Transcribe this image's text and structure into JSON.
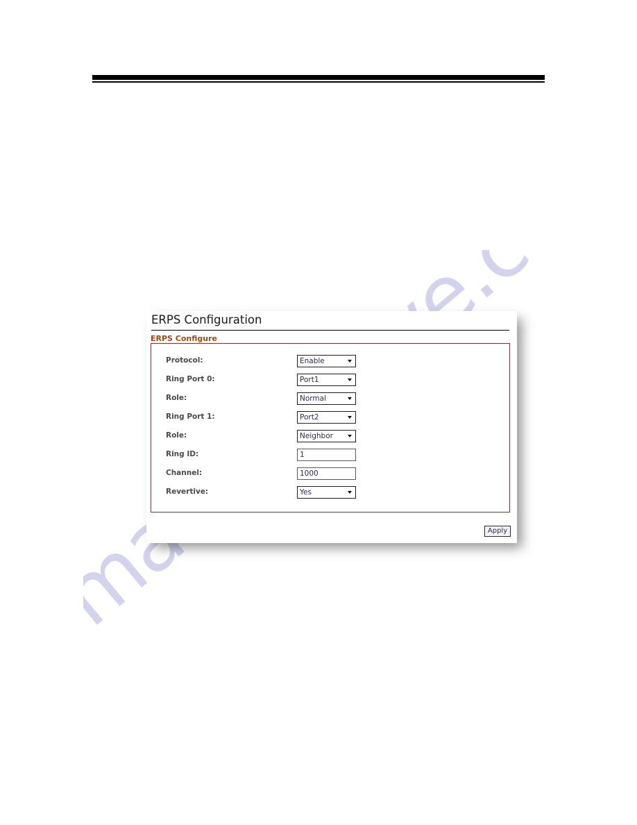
{
  "page": {
    "top_rule": "horizontal-rule"
  },
  "watermark": {
    "text": "manualshive.com",
    "color": "#b9b9e4"
  },
  "card": {
    "title": "ERPS Configuration",
    "fieldset_legend": "ERPS Configure",
    "legend_color": "#9c4a16",
    "border_color": "#8e2b2b",
    "apply_label": "Apply",
    "rows": [
      {
        "label": "Protocol:",
        "type": "select",
        "value": "Enable"
      },
      {
        "label": "Ring Port 0:",
        "type": "select",
        "value": "Port1"
      },
      {
        "label": "Role:",
        "type": "select",
        "value": "Normal"
      },
      {
        "label": "Ring Port 1:",
        "type": "select",
        "value": "Port2"
      },
      {
        "label": "Role:",
        "type": "select",
        "value": "Neighbor"
      },
      {
        "label": "Ring ID:",
        "type": "text",
        "value": "1"
      },
      {
        "label": "Channel:",
        "type": "text",
        "value": "1000"
      },
      {
        "label": "Revertive:",
        "type": "select",
        "value": "Yes"
      }
    ]
  }
}
